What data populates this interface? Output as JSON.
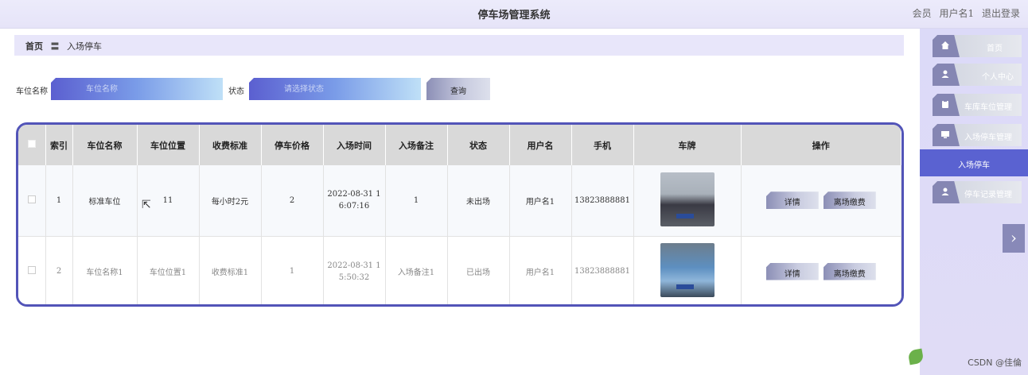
{
  "header": {
    "title": "停车场管理系统",
    "member": "会员",
    "username": "用户名1",
    "logout": "退出登录"
  },
  "breadcrumb": {
    "home": "首页",
    "sep": "〓",
    "current": "入场停车"
  },
  "search": {
    "name_label": "车位名称",
    "name_placeholder": "车位名称",
    "status_label": "状态",
    "status_placeholder": "请选择状态",
    "query_button": "查询"
  },
  "table": {
    "columns": [
      "索引",
      "车位名称",
      "车位位置",
      "收费标准",
      "停车价格",
      "入场时间",
      "入场备注",
      "状态",
      "用户名",
      "手机",
      "车牌",
      "操作"
    ],
    "rows": [
      {
        "index": "1",
        "name": "标准车位",
        "location": "11",
        "standard": "每小时2元",
        "price": "2",
        "time_a": "2022-08-31 1",
        "time_b": "6:07:16",
        "note": "1",
        "status": "未出场",
        "user": "用户名1",
        "phone": "13823888881",
        "detail": "详情",
        "leave": "离场缴费"
      },
      {
        "index": "2",
        "name": "车位名称1",
        "location": "车位位置1",
        "standard": "收费标准1",
        "price": "1",
        "time_a": "2022-08-31 1",
        "time_b": "5:50:32",
        "note": "入场备注1",
        "status": "已出场",
        "user": "用户名1",
        "phone": "13823888881",
        "detail": "详情",
        "leave": "离场缴费"
      }
    ]
  },
  "sidebar": {
    "items": [
      {
        "label": "首页",
        "icon": "home-icon"
      },
      {
        "label": "个人中心",
        "icon": "user-icon"
      },
      {
        "label": "车库车位管理",
        "icon": "clipboard-icon"
      },
      {
        "label": "入场停车管理",
        "icon": "monitor-icon"
      }
    ],
    "active": "入场停车",
    "last": {
      "label": "停车记录管理",
      "icon": "user-icon"
    }
  },
  "watermark": "CSDN @佳倫",
  "colors": {
    "accent": "#5a62d1",
    "table_border": "#5254b8",
    "header_bg": "#e6e4f8"
  }
}
